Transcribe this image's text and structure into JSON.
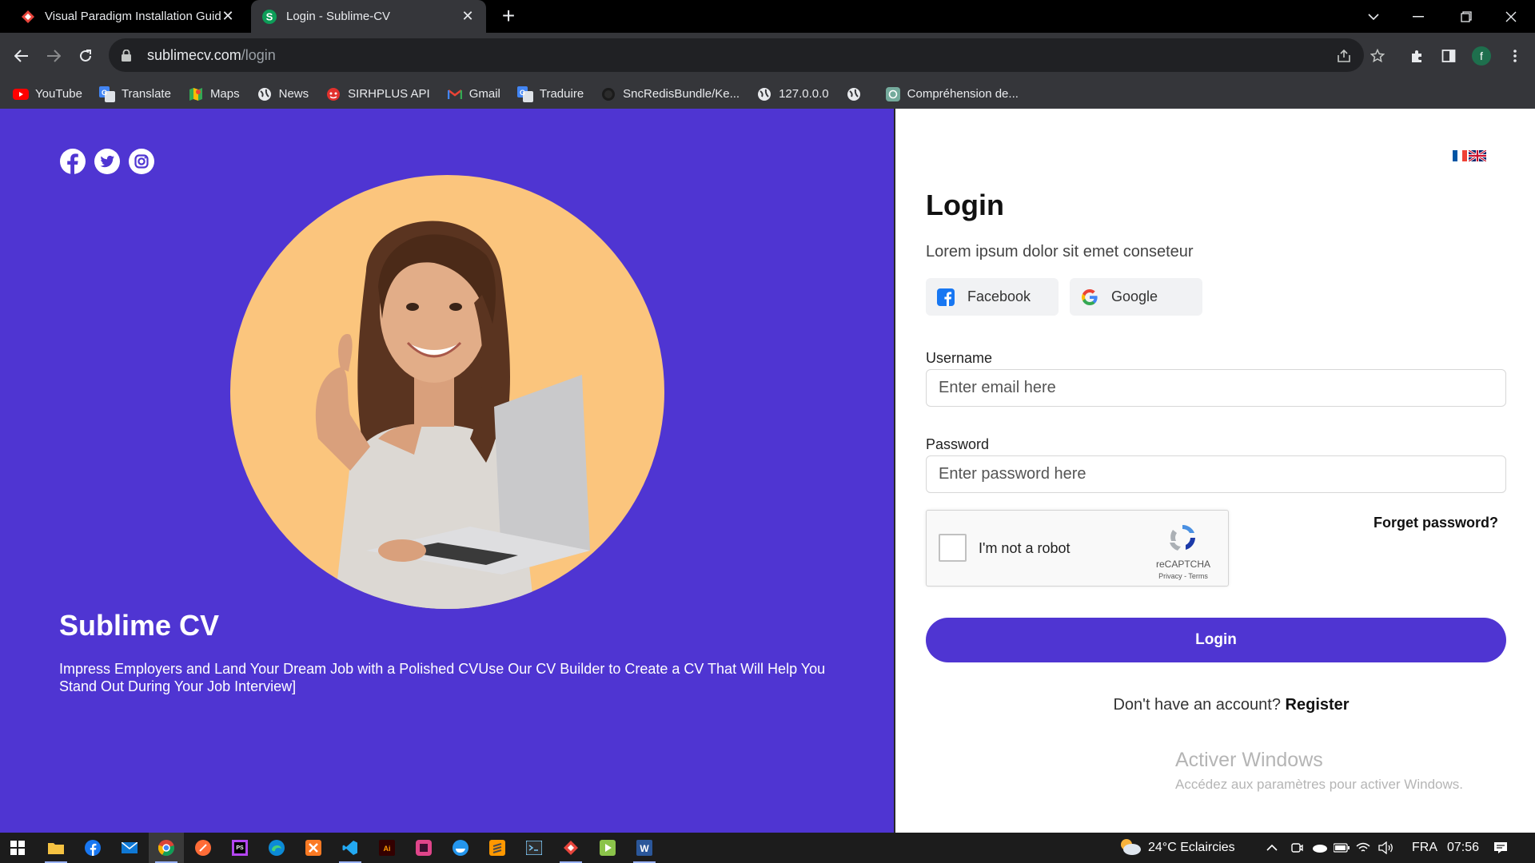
{
  "browser": {
    "tabs": [
      {
        "title": "Visual Paradigm Installation Guide",
        "active": false
      },
      {
        "title": "Login - Sublime-CV",
        "active": true
      }
    ],
    "url_host": "sublimecv.com",
    "url_path": "/login",
    "profile_initial": "f",
    "bookmarks": [
      {
        "label": "YouTube",
        "icon": "youtube-icon"
      },
      {
        "label": "Translate",
        "icon": "translate-icon"
      },
      {
        "label": "Maps",
        "icon": "maps-icon"
      },
      {
        "label": "News",
        "icon": "globe-icon"
      },
      {
        "label": "SIRHPLUS API",
        "icon": "sirhplus-icon"
      },
      {
        "label": "Gmail",
        "icon": "gmail-icon"
      },
      {
        "label": "Traduire",
        "icon": "translate-icon"
      },
      {
        "label": "SncRedisBundle/Ke...",
        "icon": "github-icon"
      },
      {
        "label": "127.0.0.0",
        "icon": "globe-icon"
      },
      {
        "label": "",
        "icon": "globe-icon"
      },
      {
        "label": "Compréhension de...",
        "icon": "openai-icon"
      }
    ]
  },
  "brand": {
    "title": "Sublime CV",
    "description": "Impress Employers and Land Your Dream Job with a Polished CVUse Our CV Builder to Create a CV That Will Help You Stand Out During Your Job Interview]",
    "accent": "#4f35d2",
    "circle_color": "#fbc57d"
  },
  "login": {
    "title": "Login",
    "subtitle": "Lorem ipsum dolor sit emet conseteur",
    "facebook_label": "Facebook",
    "google_label": "Google",
    "username_label": "Username",
    "username_placeholder": "Enter email here",
    "password_label": "Password",
    "password_placeholder": "Enter password here",
    "captcha_label": "I'm not a robot",
    "captcha_brand": "reCAPTCHA",
    "captcha_terms": "Privacy - Terms",
    "forgot_label": "Forget password?",
    "submit_label": "Login",
    "no_account_text": "Don't have an account?",
    "register_label": "Register"
  },
  "windows_notice": {
    "title": "Activer Windows",
    "subtitle": "Accédez aux paramètres pour activer Windows."
  },
  "taskbar": {
    "weather": "24°C  Eclaircies",
    "language": "FRA",
    "time": "07:56"
  }
}
